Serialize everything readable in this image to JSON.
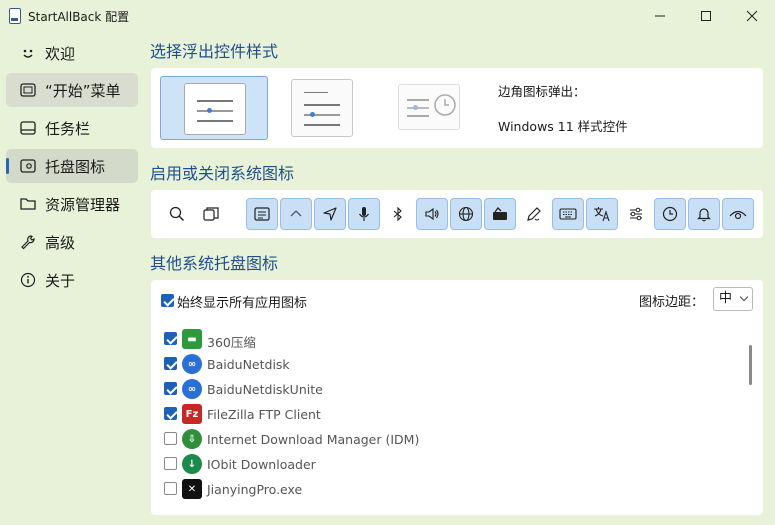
{
  "window": {
    "title": "StartAllBack 配置",
    "minimize": "—",
    "maximize": "☐",
    "close": "✕"
  },
  "sidebar": {
    "items": [
      {
        "label": "欢迎",
        "icon": "smiley-icon"
      },
      {
        "label": "“开始”菜单",
        "icon": "start-menu-icon"
      },
      {
        "label": "任务栏",
        "icon": "taskbar-icon"
      },
      {
        "label": "托盘图标",
        "icon": "tray-icon",
        "active": true
      },
      {
        "label": "资源管理器",
        "icon": "folder-icon"
      },
      {
        "label": "高级",
        "icon": "wrench-icon"
      },
      {
        "label": "关于",
        "icon": "info-icon"
      }
    ]
  },
  "flyout": {
    "title": "选择浮出控件样式",
    "label": "边角图标弹出：",
    "value": "Windows 11 样式控件"
  },
  "system_icons": {
    "title": "启用或关闭系统图标",
    "icons": [
      {
        "name": "search-icon",
        "on": false
      },
      {
        "name": "task-view-icon",
        "on": false
      },
      {
        "name": "action-center-icon",
        "on": true
      },
      {
        "name": "chevron-up-icon",
        "on": true
      },
      {
        "name": "location-icon",
        "on": true
      },
      {
        "name": "microphone-icon",
        "on": true
      },
      {
        "name": "bluetooth-icon",
        "on": false
      },
      {
        "name": "volume-icon",
        "on": true
      },
      {
        "name": "network-icon",
        "on": true
      },
      {
        "name": "power-icon",
        "on": true
      },
      {
        "name": "pen-icon",
        "on": false
      },
      {
        "name": "keyboard-icon",
        "on": true
      },
      {
        "name": "language-icon",
        "on": true
      },
      {
        "name": "settings-sliders-icon",
        "on": false
      },
      {
        "name": "clock-icon",
        "on": true
      },
      {
        "name": "notification-bell-icon",
        "on": true
      },
      {
        "name": "eye-icon",
        "on": true
      }
    ]
  },
  "other_tray": {
    "title": "其他系统托盘图标",
    "always_show_label": "始终显示所有应用图标",
    "always_show_checked": true,
    "margin_label": "图标边距：",
    "margin_value": "中",
    "apps": [
      {
        "name": "360压缩",
        "checked": true,
        "color": "#2f9a3b"
      },
      {
        "name": "BaiduNetdisk",
        "checked": true,
        "color": "#2a6fd6"
      },
      {
        "name": "BaiduNetdiskUnite",
        "checked": true,
        "color": "#2a6fd6"
      },
      {
        "name": "FileZilla FTP Client",
        "checked": true,
        "color": "#c62828"
      },
      {
        "name": "Internet Download Manager (IDM)",
        "checked": false,
        "color": "#2f8f3a"
      },
      {
        "name": "IObit Downloader",
        "checked": false,
        "color": "#1b8a4a"
      },
      {
        "name": "JianyingPro.exe",
        "checked": false,
        "color": "#111111"
      }
    ]
  }
}
